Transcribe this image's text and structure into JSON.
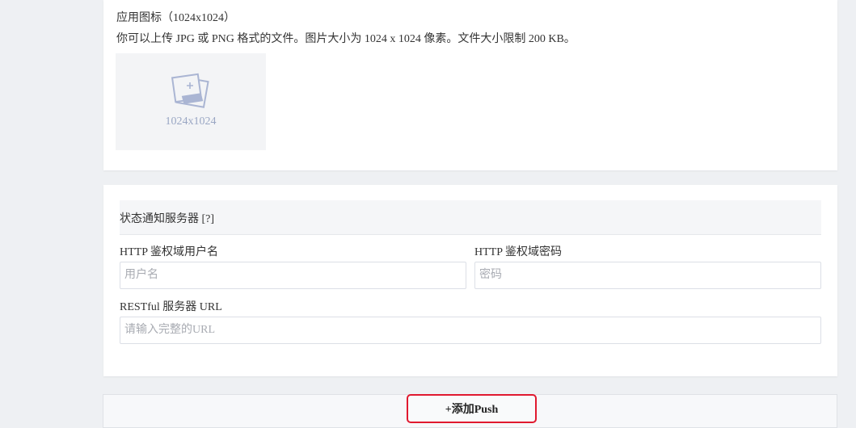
{
  "app_icon": {
    "title": "应用图标（1024x1024）",
    "description": "你可以上传 JPG 或 PNG 格式的文件。图片大小为 1024 x 1024 像素。文件大小限制 200 KB。",
    "uploader_size_label": "1024x1024",
    "icon": "image-upload-icon"
  },
  "status_server": {
    "section_title": "状态通知服务器 [?]",
    "http_user_label": "HTTP 鉴权域用户名",
    "http_user_placeholder": "用户名",
    "http_password_label": "HTTP 鉴权域密码",
    "http_password_placeholder": "密码",
    "restful_url_label": "RESTful 服务器 URL",
    "restful_url_placeholder": "请输入完整的URL"
  },
  "actions": {
    "add_push_label": "+添加Push"
  },
  "colors": {
    "highlight_border": "#e0192f",
    "page_background": "#eef0f3",
    "uploader_text": "#9aa7c4"
  }
}
